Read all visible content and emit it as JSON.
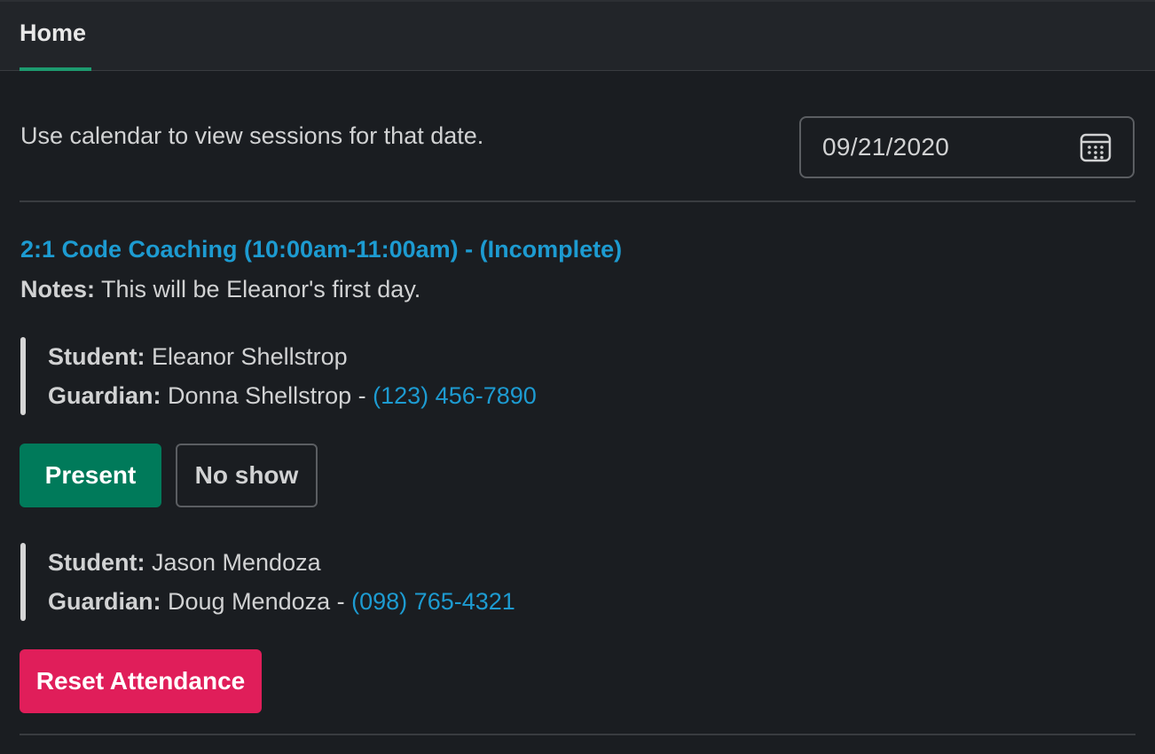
{
  "tabs": [
    {
      "label": "Home",
      "active": true
    }
  ],
  "intro": {
    "text": "Use calendar to view sessions for that date."
  },
  "date_picker": {
    "value": "09/21/2020",
    "icon": "calendar-icon"
  },
  "session": {
    "title": "2:1 Code Coaching (10:00am-11:00am) - (Incomplete)",
    "notes_label": "Notes:",
    "notes_text": " This will be Eleanor's first day.",
    "students": [
      {
        "student_label": "Student:",
        "student_name": " Eleanor Shellstrop",
        "guardian_label": "Guardian:",
        "guardian_name": " Donna Shellstrop - ",
        "guardian_phone": "(123) 456-7890"
      },
      {
        "student_label": "Student:",
        "student_name": " Jason Mendoza",
        "guardian_label": "Guardian:",
        "guardian_name": " Doug Mendoza - ",
        "guardian_phone": "(098) 765-4321"
      }
    ],
    "attendance_buttons": {
      "present": "Present",
      "no_show": "No show"
    },
    "reset_button": "Reset Attendance"
  },
  "colors": {
    "background": "#1a1d21",
    "header": "#222529",
    "accent_green": "#007a5a",
    "tab_underline": "#1d9b6f",
    "link_blue": "#1d9bd1",
    "reset_pink": "#e01e5a"
  }
}
